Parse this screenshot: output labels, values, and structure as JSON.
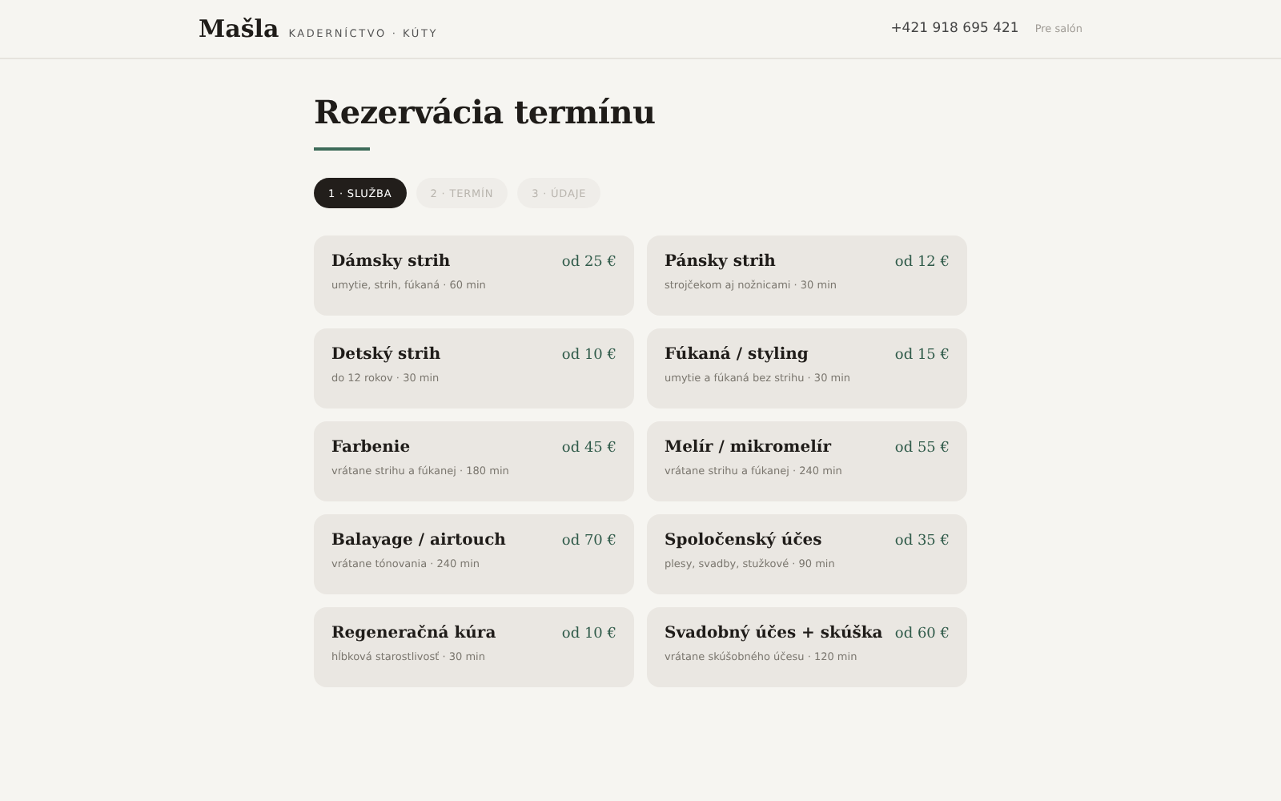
{
  "header": {
    "logo": "Mašla",
    "tagline": "KADERNÍCTVO · KÚTY",
    "phone": "+421 918 695 421",
    "link": "Pre salón"
  },
  "title": "Rezervácia termínu",
  "steps": [
    {
      "label": "1 · SLUŽBA",
      "selected": true
    },
    {
      "label": "2 · TERMÍN",
      "selected": false
    },
    {
      "label": "3 · ÚDAJE",
      "selected": false
    }
  ],
  "services": [
    {
      "name": "Dámsky strih",
      "price": "od 25 €",
      "detail": "umytie, strih, fúkaná · 60 min"
    },
    {
      "name": "Pánsky strih",
      "price": "od 12 €",
      "detail": "strojčekom aj nožnicami · 30 min"
    },
    {
      "name": "Detský strih",
      "price": "od 10 €",
      "detail": "do 12 rokov · 30 min"
    },
    {
      "name": "Fúkaná / styling",
      "price": "od 15 €",
      "detail": "umytie a fúkaná bez strihu · 30 min"
    },
    {
      "name": "Farbenie",
      "price": "od 45 €",
      "detail": "vrátane strihu a fúkanej · 180 min"
    },
    {
      "name": "Melír / mikromelír",
      "price": "od 55 €",
      "detail": "vrátane strihu a fúkanej · 240 min"
    },
    {
      "name": "Balayage / airtouch",
      "price": "od 70 €",
      "detail": "vrátane tónovania · 240 min"
    },
    {
      "name": "Spoločenský účes",
      "price": "od 35 €",
      "detail": "plesy, svadby, stužkové · 90 min"
    },
    {
      "name": "Regeneračná kúra",
      "price": "od 10 €",
      "detail": "hĺbková starostlivosť · 30 min"
    },
    {
      "name": "Svadobný účes + skúška",
      "price": "od 60 €",
      "detail": "vrátane skúšobného účesu · 120 min"
    }
  ]
}
